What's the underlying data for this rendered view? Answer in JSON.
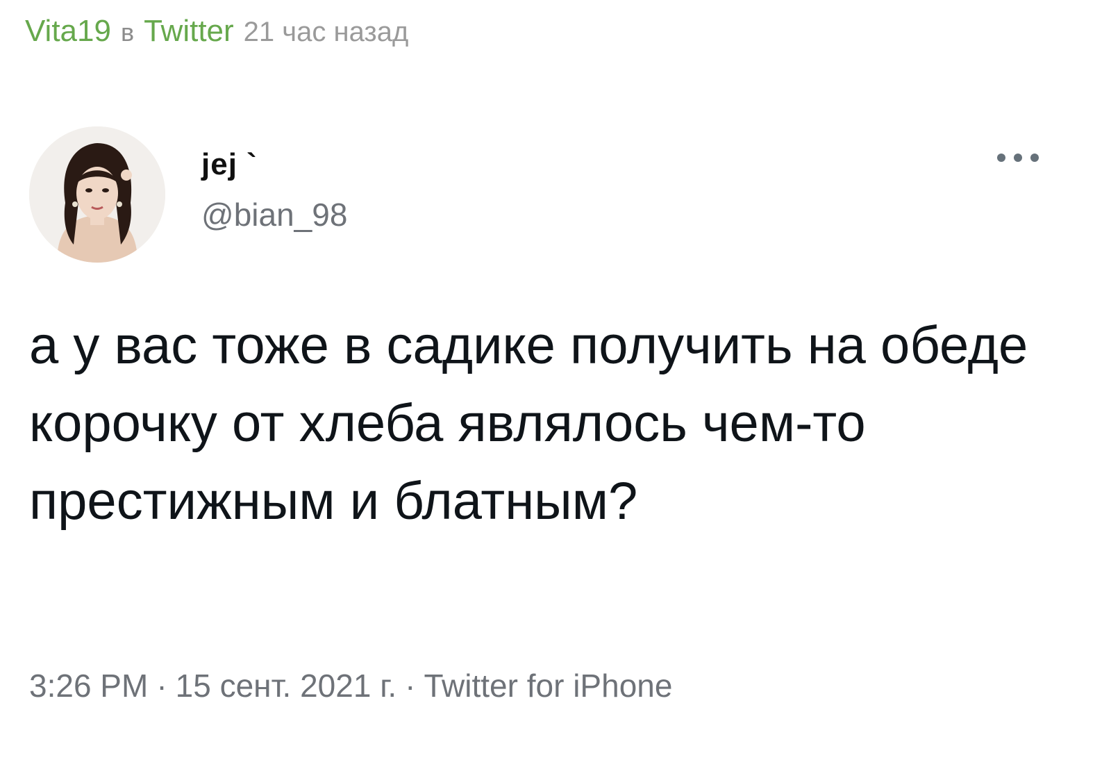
{
  "post": {
    "author": "Vita19",
    "preposition": "в",
    "source": "Twitter",
    "time_ago": "21 час назад"
  },
  "tweet": {
    "display_name": "jej `",
    "handle": "@bian_98",
    "text": "а у вас тоже в садике получить на обеде корочку от хлеба являлось чем-то престижным и блатным?",
    "time": "3:26 PM",
    "separator": "·",
    "date": "15 сент. 2021 г.",
    "client": "Twitter for iPhone"
  },
  "icons": {
    "more": "more-horizontal-icon",
    "avatar": "avatar-photo"
  },
  "colors": {
    "author_green": "#66a84c",
    "meta_gray": "#6e7278",
    "text_dark": "#0f1419"
  }
}
